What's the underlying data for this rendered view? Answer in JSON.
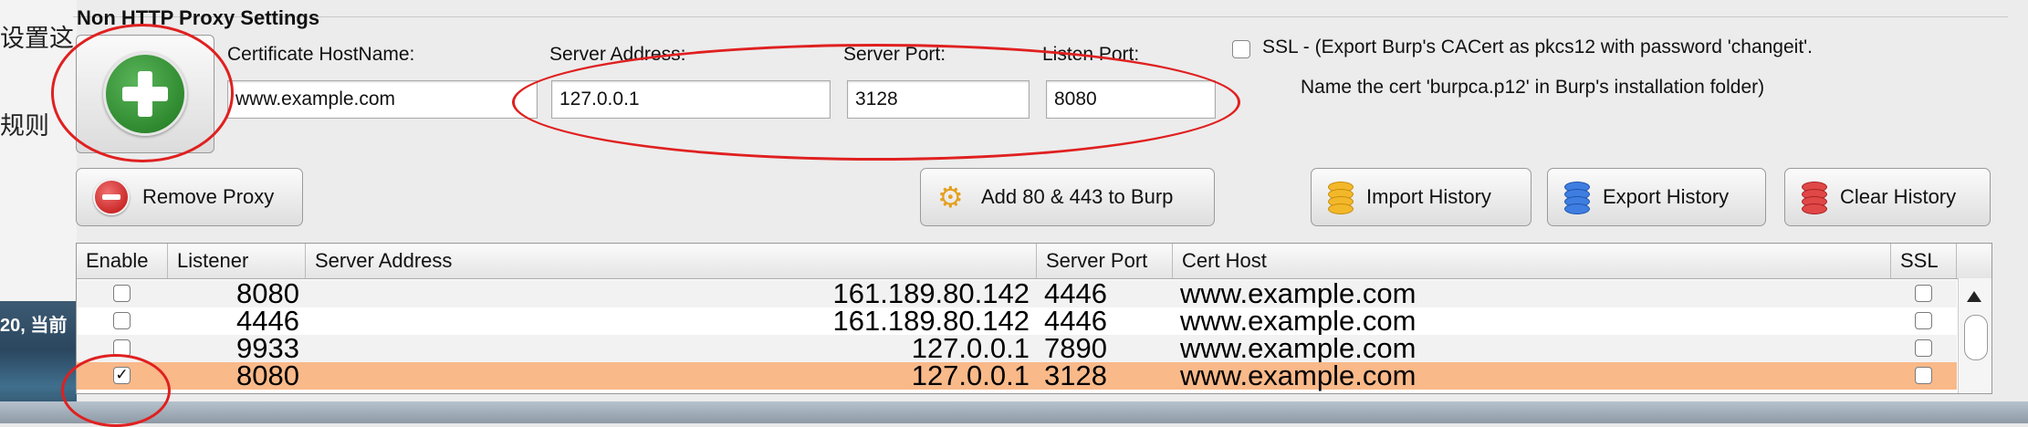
{
  "background_app": {
    "text_line_1": "设置这",
    "text_line_2": "规则",
    "photo_text": "20, 当前"
  },
  "panel": {
    "title": "Non HTTP Proxy Settings",
    "cert_hostname_label": "Certificate  HostName:",
    "cert_hostname_value": "www.example.com",
    "server_address_label": "Server Address:",
    "server_address_value": "127.0.0.1",
    "server_port_label": "Server Port:",
    "server_port_value": "3128",
    "listen_port_label": "Listen Port:",
    "listen_port_value": "8080",
    "ssl_line_1": "SSL - (Export Burp's CACert as pkcs12 with  password 'changeit'.",
    "ssl_line_2": "Name the cert 'burpca.p12'  in Burp's installation folder)"
  },
  "buttons": {
    "remove_proxy": "Remove Proxy",
    "add_ports": "Add 80 & 443 to Burp",
    "import_history": "Import History",
    "export_history": "Export History",
    "clear_history": "Clear History"
  },
  "table": {
    "headers": [
      "Enable",
      "Listener",
      "Server Address",
      "Server Port",
      "Cert Host",
      "SSL"
    ],
    "rows": [
      {
        "enabled": false,
        "listener": "8080",
        "server_address": "161.189.80.142",
        "server_port": "4446",
        "cert_host": "www.example.com",
        "ssl": false
      },
      {
        "enabled": false,
        "listener": "4446",
        "server_address": "161.189.80.142",
        "server_port": "4446",
        "cert_host": "www.example.com",
        "ssl": false
      },
      {
        "enabled": false,
        "listener": "9933",
        "server_address": "127.0.0.1",
        "server_port": "7890",
        "cert_host": "www.example.com",
        "ssl": false
      },
      {
        "enabled": true,
        "listener": "8080",
        "server_address": "127.0.0.1",
        "server_port": "3128",
        "cert_host": "www.example.com",
        "ssl": false
      }
    ],
    "check_mark": "✓"
  },
  "colors": {
    "annotation_red": "#e02020",
    "selected_row": "#f9b989",
    "add_green": "#2f8a2f"
  },
  "icons": {
    "add": "plus-circle-icon",
    "remove": "minus-circle-icon",
    "add_ports": "gears-icon",
    "import": "database-yellow-icon",
    "export": "database-blue-icon",
    "clear": "database-red-icon"
  }
}
